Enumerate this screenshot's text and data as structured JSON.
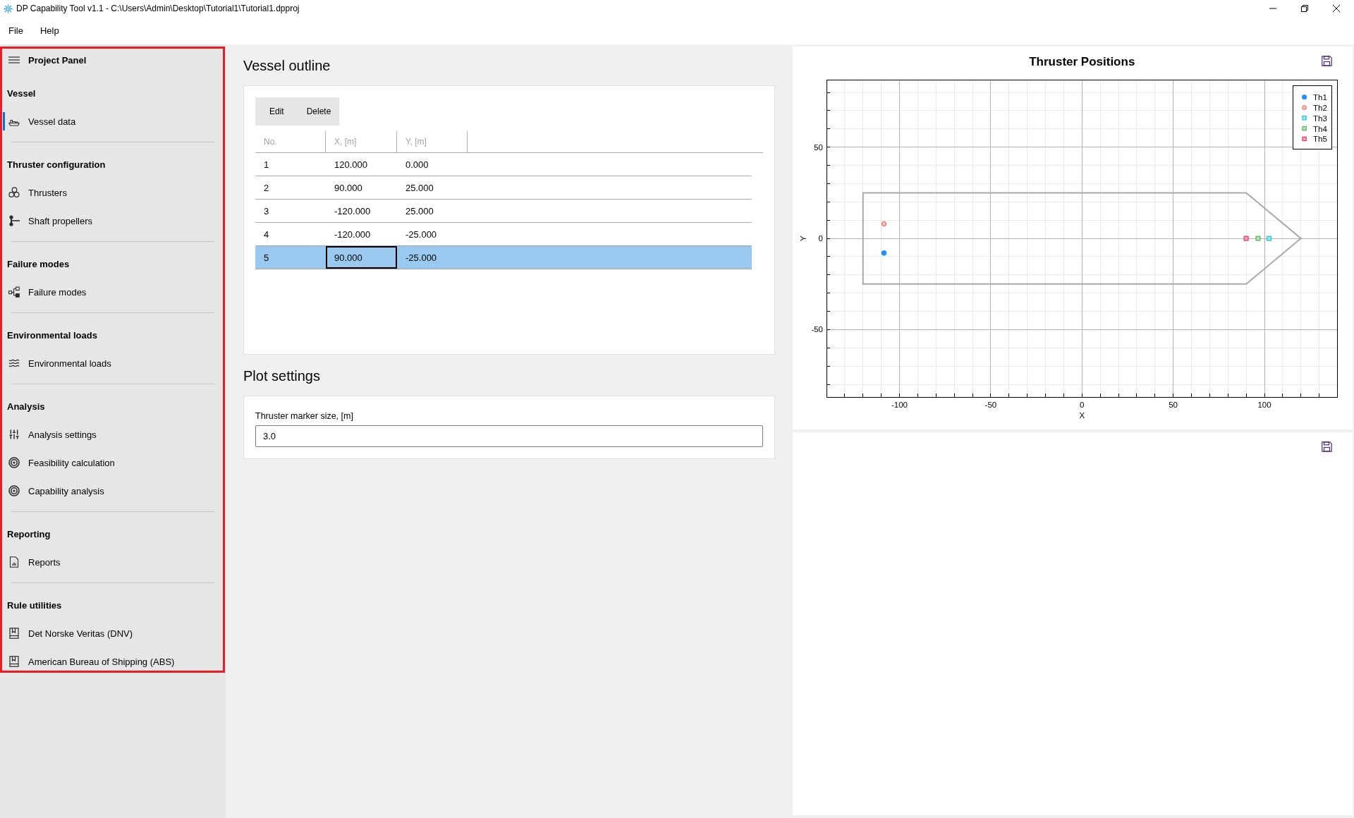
{
  "window": {
    "title": "DP Capability Tool v1.1 - C:\\Users\\Admin\\Desktop\\Tutorial1\\Tutorial1.dpproj"
  },
  "menu": [
    "File",
    "Help"
  ],
  "project_panel": {
    "title": "Project Panel",
    "highlighted": true,
    "sections": [
      {
        "title": "Vessel",
        "items": [
          {
            "label": "Vessel data",
            "selected": true
          }
        ]
      },
      {
        "title": "Thruster configuration",
        "items": [
          {
            "label": "Thrusters",
            "selected": false
          },
          {
            "label": "Shaft propellers",
            "selected": false
          }
        ]
      },
      {
        "title": "Failure modes",
        "items": [
          {
            "label": "Failure modes",
            "selected": false
          }
        ]
      },
      {
        "title": "Environmental loads",
        "items": [
          {
            "label": "Environmental loads",
            "selected": false
          }
        ]
      },
      {
        "title": "Analysis",
        "items": [
          {
            "label": "Analysis settings",
            "selected": false
          },
          {
            "label": "Feasibility calculation",
            "selected": false
          },
          {
            "label": "Capability analysis",
            "selected": false
          }
        ]
      },
      {
        "title": "Reporting",
        "items": [
          {
            "label": "Reports",
            "selected": false
          }
        ]
      },
      {
        "title": "Rule utilities",
        "items": [
          {
            "label": "Det Norske Veritas (DNV)",
            "selected": false
          },
          {
            "label": "American Bureau of Shipping (ABS)",
            "selected": false
          }
        ]
      }
    ]
  },
  "vessel_outline": {
    "title": "Vessel outline",
    "toolbar": [
      "Edit",
      "Delete"
    ],
    "table": {
      "columns": [
        "No.",
        "X, [m]",
        "Y, [m]"
      ],
      "rows": [
        {
          "selected": false,
          "cells": [
            {
              "text": "1",
              "focused": false
            },
            {
              "text": "120.000",
              "focused": false
            },
            {
              "text": "0.000",
              "focused": false
            }
          ]
        },
        {
          "selected": false,
          "cells": [
            {
              "text": "2",
              "focused": false
            },
            {
              "text": "90.000",
              "focused": false
            },
            {
              "text": "25.000",
              "focused": false
            }
          ]
        },
        {
          "selected": false,
          "cells": [
            {
              "text": "3",
              "focused": false
            },
            {
              "text": "-120.000",
              "focused": false
            },
            {
              "text": "25.000",
              "focused": false
            }
          ]
        },
        {
          "selected": false,
          "cells": [
            {
              "text": "4",
              "focused": false
            },
            {
              "text": "-120.000",
              "focused": false
            },
            {
              "text": "-25.000",
              "focused": false
            }
          ]
        },
        {
          "selected": true,
          "cells": [
            {
              "text": "5",
              "focused": false
            },
            {
              "text": "90.000",
              "focused": true
            },
            {
              "text": "-25.000",
              "focused": false
            }
          ]
        }
      ]
    }
  },
  "plot_settings": {
    "title": "Plot settings",
    "fields": [
      {
        "label": "Thruster marker size, [m]",
        "value": "3.0"
      }
    ]
  },
  "thruster_plot": {
    "chart_data": {
      "type": "scatter",
      "title": "Thruster Positions",
      "xlabel": "X",
      "ylabel": "Y",
      "xlim": [
        -140,
        140
      ],
      "ylim": [
        -87,
        87
      ],
      "xticks": [
        -100,
        -50,
        0,
        50,
        100
      ],
      "yticks": [
        -50,
        0,
        50
      ],
      "grid": true,
      "legend": "upper right",
      "series": [
        {
          "name": "Th1",
          "color": "#1e90ff",
          "marker": "filled-circle",
          "x": [
            -108.5
          ],
          "values": [
            -8
          ]
        },
        {
          "name": "Th2",
          "color": "#f4776a",
          "marker": "circle",
          "x": [
            -108.5
          ],
          "values": [
            8
          ]
        },
        {
          "name": "Th3",
          "color": "#1fc3d6",
          "marker": "square",
          "x": [
            102.5
          ],
          "values": [
            0
          ]
        },
        {
          "name": "Th4",
          "color": "#55b85a",
          "marker": "square",
          "x": [
            96.5
          ],
          "values": [
            0
          ]
        },
        {
          "name": "Th5",
          "color": "#e8356a",
          "marker": "square",
          "x": [
            90
          ],
          "values": [
            0
          ]
        }
      ]
    }
  }
}
